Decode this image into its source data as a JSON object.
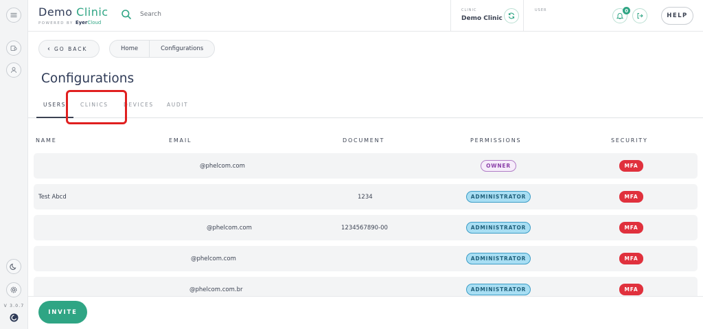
{
  "brand": {
    "title_main": "Demo",
    "title_accent": "Clinic",
    "powered_by": "POWERED BY",
    "product": "Eyer",
    "product_accent": "Cloud"
  },
  "search": {
    "placeholder": "Search"
  },
  "header": {
    "clinic_label": "CLINIC",
    "clinic_name": "Demo Clinic",
    "user_label": "USER",
    "notification_count": "0",
    "help_label": "HELP"
  },
  "rail": {
    "version": "V 3.0.7"
  },
  "nav": {
    "back_label": "GO BACK",
    "breadcrumb": [
      "Home",
      "Configurations"
    ]
  },
  "page": {
    "title": "Configurations"
  },
  "tabs": [
    "USERS",
    "CLINICS",
    "DEVICES",
    "AUDIT"
  ],
  "table": {
    "columns": [
      "NAME",
      "EMAIL",
      "DOCUMENT",
      "PERMISSIONS",
      "SECURITY"
    ],
    "rows": [
      {
        "name": "",
        "email": "@phelcom.com",
        "document": "",
        "permission": "OWNER",
        "security": "MFA"
      },
      {
        "name": "Test Abcd",
        "email": "",
        "document": "1234",
        "permission": "ADMINISTRATOR",
        "security": "MFA"
      },
      {
        "name": "",
        "email": "@phelcom.com",
        "document": "1234567890-00",
        "permission": "ADMINISTRATOR",
        "security": "MFA"
      },
      {
        "name": "",
        "email": "@phelcom.com",
        "document": "",
        "permission": "ADMINISTRATOR",
        "security": "MFA"
      },
      {
        "name": "",
        "email": "@phelcom.com.br",
        "document": "",
        "permission": "ADMINISTRATOR",
        "security": "MFA"
      }
    ]
  },
  "footer": {
    "invite_label": "INVITE"
  },
  "colors": {
    "accent": "#2fa584",
    "highlight": "#e01f1f",
    "admin_badge": "#a8def3",
    "owner_badge": "#f6ecfa",
    "mfa_badge": "#e0313d"
  }
}
